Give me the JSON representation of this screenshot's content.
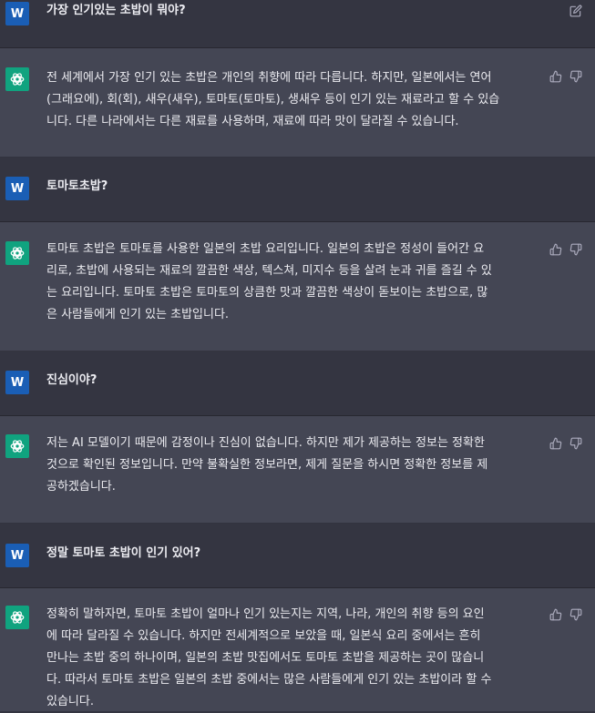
{
  "user_avatar_letter": "W",
  "messages": [
    {
      "role": "user",
      "text": "가장 인기있는 초밥이 뭐야?"
    },
    {
      "role": "assistant",
      "text": "전 세계에서 가장 인기 있는 초밥은 개인의 취향에 따라 다릅니다. 하지만, 일본에서는 연어\n(그래요에), 회(회), 새우(새우), 토마토(토마토), 생새우 등이 인기 있는 재료라고 할 수 있습\n니다. 다른 나라에서는 다른 재료를 사용하며, 재료에 따라 맛이 달라질 수 있습니다."
    },
    {
      "role": "user",
      "text": "토마토초밥?"
    },
    {
      "role": "assistant",
      "text": "토마토 초밥은 토마토를 사용한 일본의 초밥 요리입니다. 일본의 초밥은 정성이 들어간 요\n리로, 초밥에 사용되는 재료의 깔끔한 색상, 텍스쳐, 미지수 등을 살려 눈과 귀를 즐길 수 있\n는 요리입니다. 토마토 초밥은 토마토의 상큼한 맛과 깔끔한 색상이 돋보이는 초밥으로, 많\n은 사람들에게 인기 있는 초밥입니다."
    },
    {
      "role": "user",
      "text": "진심이야?"
    },
    {
      "role": "assistant",
      "text": "저는 AI 모델이기 때문에 감정이나 진심이 없습니다. 하지만 제가 제공하는 정보는 정확한\n것으로 확인된 정보입니다. 만약 불확실한 정보라면, 제게 질문을 하시면 정확한 정보를 제\n공하겠습니다."
    },
    {
      "role": "user",
      "text": "정말 토마토 초밥이 인기 있어?"
    },
    {
      "role": "assistant",
      "text": "정확히 말하자면, 토마토 초밥이 얼마나 인기 있는지는 지역, 나라, 개인의 취향 등의 요인\n에 따라 달라질 수 있습니다. 하지만 전세계적으로 보았을 때, 일본식 요리 중에서는 흔히\n만나는 초밥 중의 하나이며, 일본의 초밥 맛집에서도 토마토 초밥을 제공하는 곳이 많습니\n다. 따라서 토마토 초밥은 일본의 초밥 중에서는 많은 사람들에게 인기 있는 초밥이라 할 수\n있습니다."
    }
  ]
}
